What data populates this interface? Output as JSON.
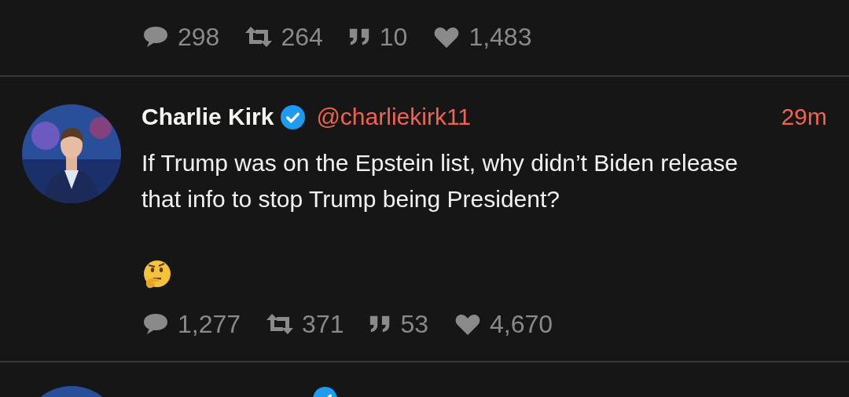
{
  "tweets": [
    {
      "kind": "stats_only",
      "stats": {
        "replies": "298",
        "retweets": "264",
        "quotes": "10",
        "likes": "1,483"
      }
    },
    {
      "kind": "full",
      "name": "Charlie Kirk",
      "verified": true,
      "handle": "@charliekirk11",
      "time": "29m",
      "text": "If Trump was on the Epstein list, why didn’t Biden release that info to stop Trump being President?",
      "stats": {
        "replies": "1,277",
        "retweets": "371",
        "quotes": "53",
        "likes": "4,670"
      }
    },
    {
      "kind": "header_only",
      "verified": true
    }
  ]
}
